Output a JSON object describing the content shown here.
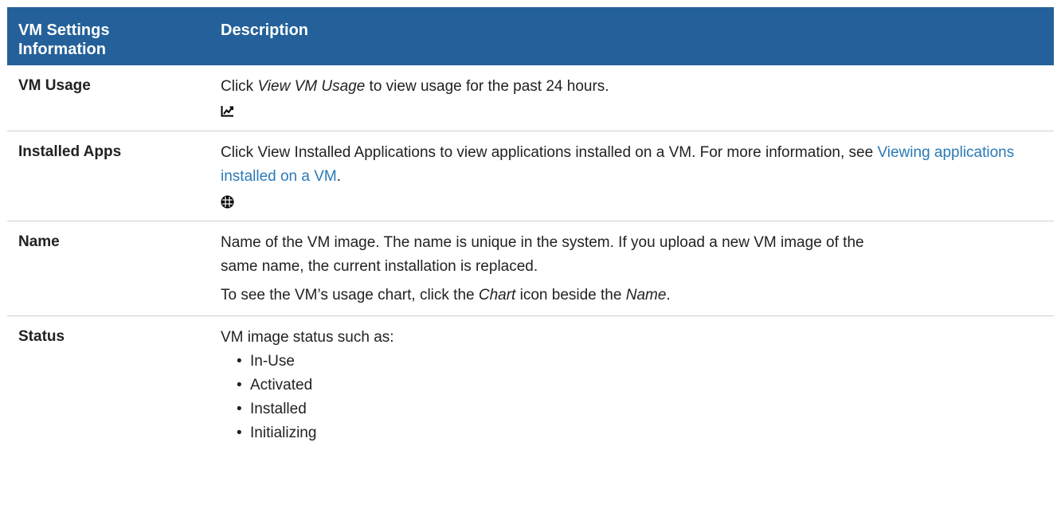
{
  "header": {
    "col1": "VM Settings Information",
    "col2": "Description"
  },
  "rows": {
    "usage": {
      "label": "VM Usage",
      "text_before": "Click ",
      "text_em": "View VM Usage",
      "text_after": " to view usage for the past 24 hours.",
      "icon": "chart-icon"
    },
    "apps": {
      "label": "Installed Apps",
      "text_before": "Click View Installed Applications to view applications installed on a VM. For more information, see ",
      "link": "Viewing applications installed on a VM",
      "text_after": ".",
      "icon": "grid-icon"
    },
    "name": {
      "label": "Name",
      "para1": "Name of the VM image. The name is unique in the system. If you upload a new VM image of the same name, the current installation is replaced.",
      "para2_a": "To see the VM’s usage chart, click the ",
      "para2_em1": "Chart",
      "para2_b": " icon beside the ",
      "para2_em2": "Name",
      "para2_c": "."
    },
    "status": {
      "label": "Status",
      "intro": "VM image status such as:",
      "items": [
        "In-Use",
        "Activated",
        "Installed",
        "Initializing"
      ]
    }
  },
  "colors": {
    "header_bg": "#24619a",
    "link": "#2a7ab8"
  }
}
